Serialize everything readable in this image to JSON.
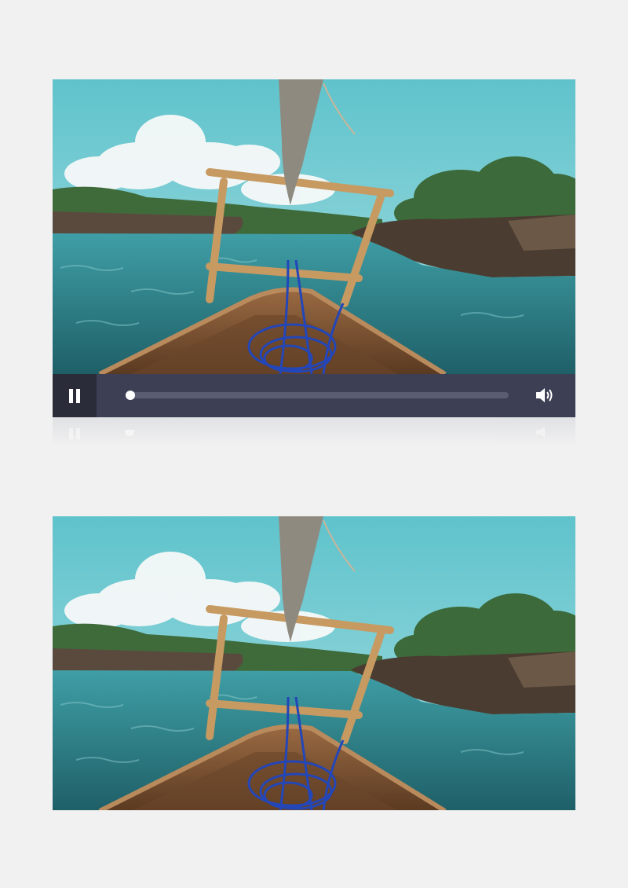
{
  "player": {
    "state": "playing",
    "progress": 0.0,
    "buttons": {
      "play_pause_icon": "pause-icon",
      "volume_icon": "volume-icon"
    },
    "colors": {
      "controls_bg": "#3d4054",
      "button_bg": "#2a2c3a",
      "track": "#5a5d72",
      "knob": "#ffffff",
      "page_bg": "#f1f1f1"
    }
  },
  "frames": [
    {
      "id": "video-preview-top",
      "scene": "boat-bow-on-turquoise-water"
    },
    {
      "id": "video-preview-bottom",
      "scene": "boat-bow-on-turquoise-water"
    }
  ]
}
